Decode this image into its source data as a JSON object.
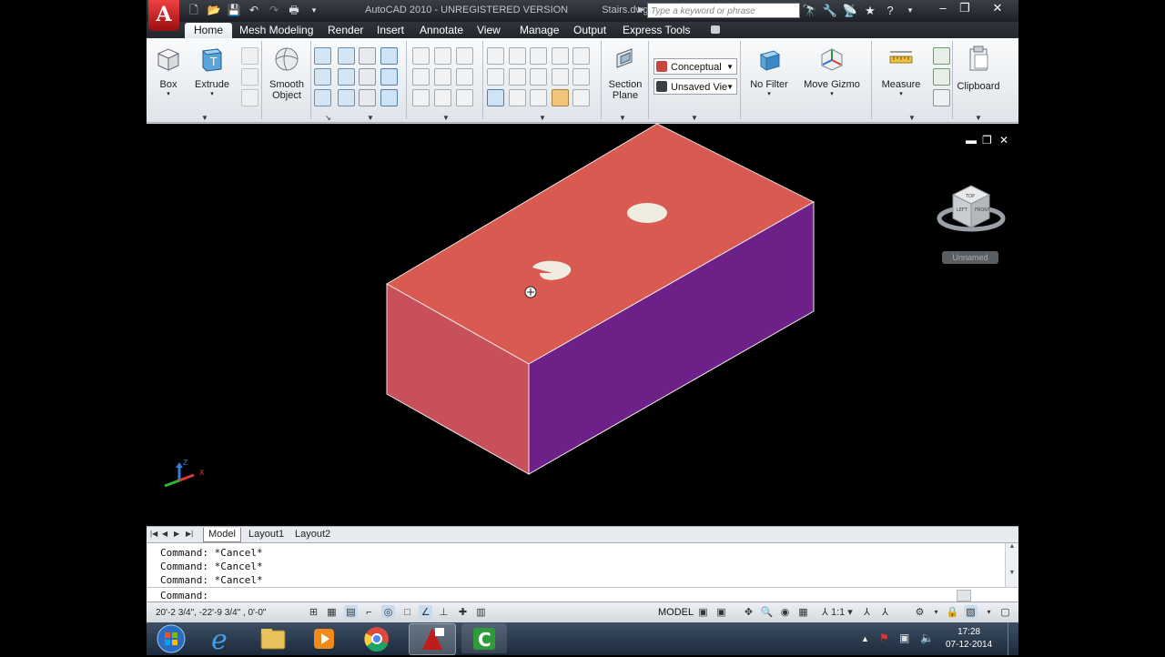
{
  "window": {
    "title": "AutoCAD 2010 - UNREGISTERED VERSION",
    "filename": "Stairs.dwg",
    "search_placeholder": "Type a keyword or phrase"
  },
  "tabs": [
    "Home",
    "Mesh Modeling",
    "Render",
    "Insert",
    "Annotate",
    "View",
    "Manage",
    "Output",
    "Express Tools"
  ],
  "active_tab": "Home",
  "ribbon": {
    "box": "Box",
    "extrude": "Extrude",
    "smooth_object_1": "Smooth",
    "smooth_object_2": "Object",
    "section_plane_1": "Section",
    "section_plane_2": "Plane",
    "visual_style": "Conceptual",
    "view": "Unsaved Vie",
    "no_filter": "No Filter",
    "move_gizmo": "Move Gizmo",
    "measure": "Measure",
    "clipboard": "Clipboard"
  },
  "viewcube": {
    "label": "Unnamed",
    "faces": [
      "TOP",
      "LEFT",
      "FRONT"
    ]
  },
  "ucs_axes": {
    "z": "Z",
    "x": "X"
  },
  "layout_tabs": [
    "Model",
    "Layout1",
    "Layout2"
  ],
  "active_layout": "Model",
  "command_history": [
    "Command: *Cancel*",
    "Command: *Cancel*",
    "Command: *Cancel*"
  ],
  "command_prompt": "Command:",
  "status": {
    "coordinates": "20'-2 3/4\",  -22'-9 3/4\" , 0'-0\"",
    "space": "MODEL",
    "annotation_scale": "1:1"
  },
  "taskbar": {
    "time": "17:28",
    "date": "07-12-2014",
    "apps": [
      "start-orb",
      "internet-explorer",
      "file-explorer",
      "media-player",
      "chrome",
      "autocad-2010",
      "camtasia"
    ]
  },
  "colors": {
    "box_top": "#d85a50",
    "box_front": "#c8505a",
    "box_side": "#6c2088",
    "viewport_bg": "#000000",
    "ribbon_bg": "#e9edf1"
  }
}
